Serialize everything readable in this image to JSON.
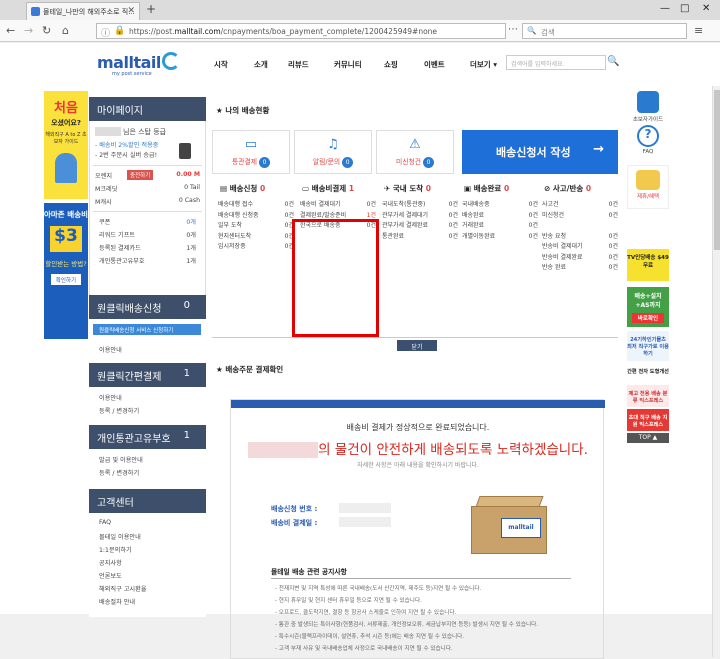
{
  "browser": {
    "tab_title": "몰테일_나만의 해외주소로 직...",
    "url_prefix": "https://post.",
    "url_domain": "malltail.com",
    "url_path": "/cnpayments/boa_payment_complete/1200425949#none",
    "search_placeholder": "검색",
    "win_min": "—",
    "win_max": "□",
    "win_close": "✕"
  },
  "site": {
    "logo": "malltail",
    "logo_sub": "my post service",
    "nav": [
      "시작",
      "소개",
      "리뷰드",
      "커뮤니티",
      "쇼핑",
      "이벤트",
      "더보기 ▾"
    ],
    "search_placeholder": "검색어를 입력하세요."
  },
  "left_banner": {
    "b1_big": "처음",
    "b1_mid": "오셨어요?",
    "b1_small": "해외직구 A to Z 초보자 가이드",
    "b2_title": "아마존 배송비",
    "b2_price": "$3",
    "b2_sub": "할인받는 방법?",
    "b2_btn": "확인하기"
  },
  "sidebar": {
    "mypage": "마이페이지",
    "grade": "님은 스탑 등급",
    "grade_lines": [
      "- 배송비 2%할인 적용중",
      "- 2번 주문시 실버 승급!"
    ],
    "orange": "오렌지",
    "charge_btn": "충전하기",
    "orange_val": "0.00 M",
    "mcredit": "M크레딧",
    "mcredit_val": "0 Tail",
    "mcash": "M캐시",
    "mcash_val": "0 Cash",
    "stats": [
      {
        "label": "쿠폰",
        "val": "0개"
      },
      {
        "label": "리워드 기프트",
        "val": "0개"
      },
      {
        "label": "등록된 결제카드",
        "val": "1개"
      },
      {
        "label": "개인통관고유부호",
        "val": "1개"
      }
    ],
    "oneclick": "원클릭배송신청",
    "oneclick_num": "0",
    "oneclick_btn": "원클릭배송신청 서비스 신청하기",
    "oneclick_link": "이용안내",
    "oneclick_pay": "원클릭간편결제",
    "oneclick_pay_num": "1",
    "oneclick_pay_links": [
      "이용안내",
      "등록 / 변경하기"
    ],
    "customs": "개인통관고유부호",
    "customs_num": "1",
    "customs_links": [
      "발급 및 이용안내",
      "등록 / 변경하기"
    ],
    "cs": "고객센터",
    "cs_links": [
      "FAQ",
      "몰테일 이용안내",
      "1:1문의하기",
      "공지사항",
      "언론보도",
      "해외직구 고시환율",
      "배송절차 안내"
    ]
  },
  "content": {
    "status_title": "나의 배송현황",
    "cards": [
      {
        "label": "통관결제",
        "count": "0",
        "icon": "card-icon"
      },
      {
        "label": "알림/문의",
        "count": "0",
        "icon": "bell-icon"
      },
      {
        "label": "미신청건",
        "count": "0",
        "icon": "alarm-icon"
      }
    ],
    "apply_btn": "배송신청서 작성",
    "apply_arrow": "→",
    "columns": [
      {
        "title": "배송신청",
        "count": "0",
        "rows": [
          [
            "배송대행 접수",
            "0건"
          ],
          [
            "배송대행 신청중",
            "0건"
          ],
          [
            "일부 도착",
            "0건"
          ],
          [
            "현지센터도착",
            "0건"
          ],
          [
            "임시저장중",
            "0건"
          ]
        ]
      },
      {
        "title": "배송비결제",
        "count": "1",
        "rows": [
          [
            "배송비 결제대기",
            "0건"
          ],
          [
            "결제완료/발송준비",
            "1건"
          ],
          [
            "한국으로 배송중",
            "0건"
          ]
        ]
      },
      {
        "title": "국내 도착",
        "count": "0",
        "rows": [
          [
            "국내도착(통관중)",
            "0건"
          ],
          [
            "관부가세 결제대기",
            "0건"
          ],
          [
            "관부가세 결제완료",
            "0건"
          ],
          [
            "통관완료",
            "0건"
          ]
        ]
      },
      {
        "title": "배송완료",
        "count": "0",
        "rows": [
          [
            "국내배송중",
            "0건"
          ],
          [
            "배송완료",
            "0건"
          ],
          [
            "거래완료",
            "0건"
          ],
          [
            "개별이동완료",
            "0건"
          ]
        ]
      },
      {
        "title": "사고/반송",
        "count": "0",
        "rows": [
          [
            "사고건",
            "0건"
          ],
          [
            "미신청건",
            "0건"
          ],
          [
            "",
            ""
          ],
          [
            "반송 요청",
            "0건"
          ],
          [
            "반송비 결제대기",
            "0건"
          ],
          [
            "반송비 결제완료",
            "0건"
          ],
          [
            "반송 완료",
            "0건"
          ]
        ]
      }
    ],
    "close_btn": "닫기",
    "payment_title": "배송주문 결제확인",
    "msg1": "배송비 결제가 정상적으로 완료되었습니다.",
    "msg2": "의 물건이 안전하게 배송되도록 노력하겠습니다.",
    "msg3": "자세한 사항은 아래 내용을 확인하시기 바랍니다.",
    "field1": "배송신청 번호 :",
    "field2": "배송비 결제일 :",
    "box_label": "malltail",
    "notice_title": "몰테일 배송 관련 공지사항",
    "notice_lines": [
      "- 천재지변 및 지역 특성에 따른 국내배송(도서 산간지역, 제주도 등)지연 될 수 있습니다.",
      "- 현지 휴무일 및 현지 센터 휴무일 등으로 지연 될 수 있습니다.",
      "- 오프로드, 클도착지연, 결항 등 항공사 스케줄로 인하여 지연 될 수 있습니다.",
      "- 통관 중 발생되는 특이사항(현품검사, 서류제출, 개인정보오류, 세금납부지연 등등) 발생시 지연 될 수 있습니다.",
      "- 특수시즌(블랙프라이데이, 설연휴, 추석 시즌 등)에는 배송 지연 될 수 있습니다.",
      "- 고객 부재 사유 및 국내배송업체 사정으로 국내배송이 지연 될 수 있습니다."
    ]
  },
  "right_banner": {
    "guide": "초보자가이드",
    "faq": "FAQ",
    "event": "제휴/혜택",
    "tv": "TV인당배송 $49 무료",
    "ad1": "배송+설치 +AS까지",
    "ad1_btn": "바로확인",
    "ad2": "24기하인기몰츠 최저 직구가로 이용하기",
    "ad3": "간편 전자 도형개선",
    "ad4": "제고 전용 배송 분류 익스프레스",
    "ad5": "초대 직구 배송 지원 익스프레스",
    "top": "TOP ▲"
  }
}
